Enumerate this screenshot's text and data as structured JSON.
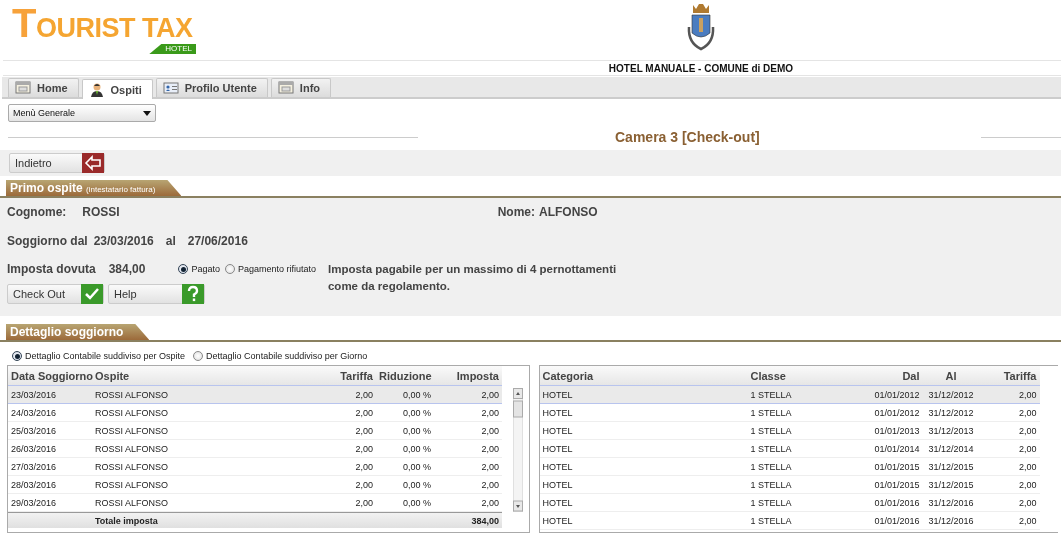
{
  "logo": {
    "title": "TOURIST TAX",
    "badge": "HOTEL"
  },
  "header": {
    "title": "HOTEL MANUALE - COMUNE di DEMO"
  },
  "tabs": [
    {
      "label": "Home",
      "selected": false
    },
    {
      "label": "Ospiti",
      "selected": true
    },
    {
      "label": "Profilo Utente",
      "selected": false
    },
    {
      "label": "Info",
      "selected": false
    }
  ],
  "menu_select": {
    "value": "Menù Generale"
  },
  "page_title": "Camera 3 [Check-out]",
  "back_button": {
    "label": "Indietro"
  },
  "guest_section": {
    "title": "Primo ospite",
    "subtitle": "(intestatario fattura)",
    "surname_label": "Cognome:",
    "surname": "ROSSI",
    "name_label": "Nome:",
    "name": "ALFONSO",
    "stay_label": "Soggiorno dal",
    "stay_from": "23/03/2016",
    "stay_to_label": "al",
    "stay_to": "27/06/2016",
    "tax_label": "Imposta dovuta",
    "tax": "384,00",
    "payment_options": [
      {
        "label": "Pagato",
        "selected": true
      },
      {
        "label": "Pagamento rifiutato",
        "selected": false
      }
    ],
    "note": "Imposta pagabile per un massimo di 4 pernottamenti come da regolamento.",
    "buttons": [
      {
        "label": "Check Out",
        "kind": "check"
      },
      {
        "label": "Help",
        "kind": "help"
      }
    ]
  },
  "detail_section": {
    "title": "Dettaglio soggiorno",
    "view_options": [
      {
        "label": "Dettaglio Contabile suddiviso per Ospite",
        "selected": true
      },
      {
        "label": "Dettaglio Contabile suddiviso per Giorno",
        "selected": false
      }
    ]
  },
  "stay_table": {
    "columns": [
      "Data Soggiorno",
      "Ospite",
      "Tariffa",
      "Riduzione",
      "Imposta"
    ],
    "rows": [
      {
        "cells": [
          "23/03/2016",
          "ROSSI ALFONSO",
          "2,00",
          "0,00 %",
          "2,00"
        ],
        "selected": true
      },
      {
        "cells": [
          "24/03/2016",
          "ROSSI ALFONSO",
          "2,00",
          "0,00 %",
          "2,00"
        ],
        "selected": false
      },
      {
        "cells": [
          "25/03/2016",
          "ROSSI ALFONSO",
          "2,00",
          "0,00 %",
          "2,00"
        ],
        "selected": false
      },
      {
        "cells": [
          "26/03/2016",
          "ROSSI ALFONSO",
          "2,00",
          "0,00 %",
          "2,00"
        ],
        "selected": false
      },
      {
        "cells": [
          "27/03/2016",
          "ROSSI ALFONSO",
          "2,00",
          "0,00 %",
          "2,00"
        ],
        "selected": false
      },
      {
        "cells": [
          "28/03/2016",
          "ROSSI ALFONSO",
          "2,00",
          "0,00 %",
          "2,00"
        ],
        "selected": false
      },
      {
        "cells": [
          "29/03/2016",
          "ROSSI ALFONSO",
          "2,00",
          "0,00 %",
          "2,00"
        ],
        "selected": false
      }
    ],
    "total_label": "Totale imposta",
    "total": "384,00"
  },
  "rate_table": {
    "columns": [
      "Categoria",
      "Classe",
      "Dal",
      "Al",
      "Tariffa"
    ],
    "rows": [
      {
        "cells": [
          "HOTEL",
          "1 STELLA",
          "01/01/2012",
          "31/12/2012",
          "2,00"
        ],
        "selected": true
      },
      {
        "cells": [
          "HOTEL",
          "1 STELLA",
          "01/01/2012",
          "31/12/2012",
          "2,00"
        ],
        "selected": false
      },
      {
        "cells": [
          "HOTEL",
          "1 STELLA",
          "01/01/2013",
          "31/12/2013",
          "2,00"
        ],
        "selected": false
      },
      {
        "cells": [
          "HOTEL",
          "1 STELLA",
          "01/01/2014",
          "31/12/2014",
          "2,00"
        ],
        "selected": false
      },
      {
        "cells": [
          "HOTEL",
          "1 STELLA",
          "01/01/2015",
          "31/12/2015",
          "2,00"
        ],
        "selected": false
      },
      {
        "cells": [
          "HOTEL",
          "1 STELLA",
          "01/01/2015",
          "31/12/2015",
          "2,00"
        ],
        "selected": false
      },
      {
        "cells": [
          "HOTEL",
          "1 STELLA",
          "01/01/2016",
          "31/12/2016",
          "2,00"
        ],
        "selected": false
      },
      {
        "cells": [
          "HOTEL",
          "1 STELLA",
          "01/01/2016",
          "31/12/2016",
          "2,00"
        ],
        "selected": false
      }
    ]
  }
}
